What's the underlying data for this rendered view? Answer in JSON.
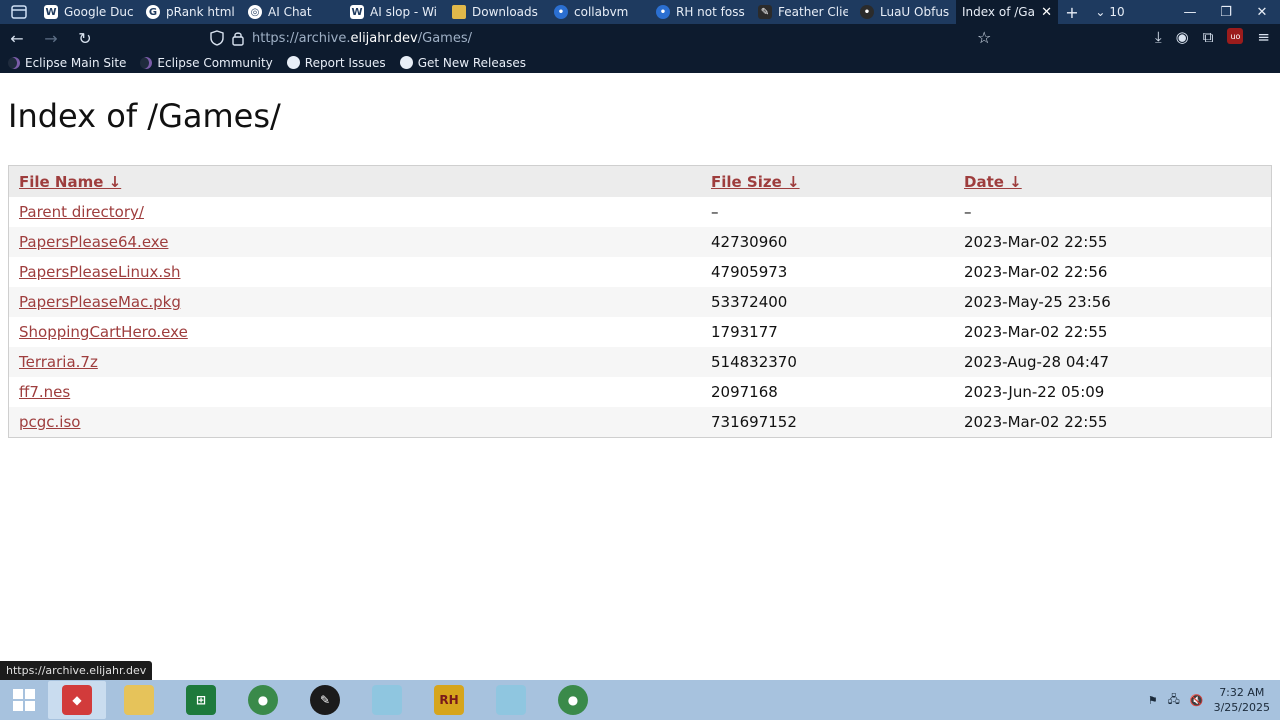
{
  "browser": {
    "tabs": [
      {
        "label": "Google Duc",
        "fav": "W"
      },
      {
        "label": "pRank html",
        "fav": "G"
      },
      {
        "label": "AI Chat",
        "fav": "◎"
      },
      {
        "label": "AI slop - Wi",
        "fav": "W"
      },
      {
        "label": "Downloads",
        "fav": ""
      },
      {
        "label": "collabvm",
        "fav": "•"
      },
      {
        "label": "RH not foss",
        "fav": "•"
      },
      {
        "label": "Feather Clie",
        "fav": "✎"
      },
      {
        "label": "LuaU Obfus",
        "fav": "•"
      },
      {
        "label": "Index of /Ga",
        "fav": ""
      }
    ],
    "tab_count": "10",
    "url_prefix": "https://archive.",
    "url_host": "elijahr.dev",
    "url_path": "/Games/",
    "bookmarks": [
      "Eclipse Main Site",
      "Eclipse Community",
      "Report Issues",
      "Get New Releases"
    ]
  },
  "page": {
    "title": "Index of /Games/",
    "headers": {
      "name": "File Name  ↓",
      "size": "File Size  ↓",
      "date": "Date  ↓"
    },
    "rows": [
      {
        "name": "Parent directory/",
        "size": "–",
        "date": "–"
      },
      {
        "name": "PapersPlease64.exe",
        "size": "42730960",
        "date": "2023-Mar-02 22:55"
      },
      {
        "name": "PapersPleaseLinux.sh",
        "size": "47905973",
        "date": "2023-Mar-02 22:56"
      },
      {
        "name": "PapersPleaseMac.pkg",
        "size": "53372400",
        "date": "2023-May-25 23:56"
      },
      {
        "name": "ShoppingCartHero.exe",
        "size": "1793177",
        "date": "2023-Mar-02 22:55"
      },
      {
        "name": "Terraria.7z",
        "size": "514832370",
        "date": "2023-Aug-28 04:47"
      },
      {
        "name": "ff7.nes",
        "size": "2097168",
        "date": "2023-Jun-22 05:09"
      },
      {
        "name": "pcgc.iso",
        "size": "731697152",
        "date": "2023-Mar-02 22:55"
      }
    ]
  },
  "status_url": "https://archive.elijahr.dev",
  "taskbar": {
    "time": "7:32 AM",
    "date": "3/25/2025",
    "rh_label": "RH"
  },
  "colors": {
    "link": "#9e3d3d",
    "tab_bg": "#1e3a5f",
    "toolbar_bg": "#0d1b2e",
    "taskbar_bg": "#a7c2de"
  }
}
